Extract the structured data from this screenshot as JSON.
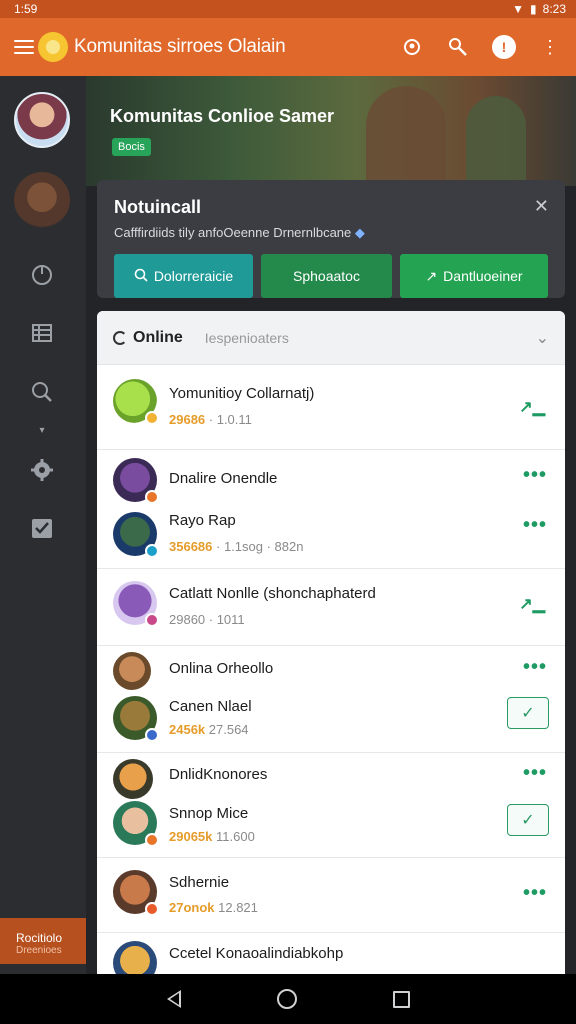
{
  "status": {
    "time": "1:59",
    "right_time": "8:23"
  },
  "app": {
    "title": "Komunitas sirroes Olaiain"
  },
  "banner": {
    "title": "Komunitas Conlioe Samer",
    "tag": "Bocis"
  },
  "rail": {
    "bottom_line1": "Rocitiolo",
    "bottom_line2": "Dreenioes"
  },
  "notice": {
    "title": "Notuincall",
    "text": "Cafffirdiids tily anfoOeenne Drnernlbcane",
    "buttons": [
      {
        "label": "Dolorreraicie"
      },
      {
        "label": "Sphoaatoc"
      },
      {
        "label": "Dantluoeiner"
      }
    ]
  },
  "list": {
    "header": {
      "tab": "Online",
      "sub": "Iespenioaters"
    },
    "rows": [
      {
        "name": "Yomunitioy Collarnatj)",
        "num": "29686",
        "meta": " · 1.0.11",
        "action": "trend"
      },
      {
        "name": "Dnalire Onendle",
        "num": "",
        "meta": "",
        "action": "more"
      },
      {
        "name": "Rayo Rap",
        "num": "356686",
        "meta": " · 1.1sog · 882n",
        "action": "more"
      },
      {
        "name": "Catlatt Nonlle (shonchaphaterd",
        "num": "",
        "meta": "29860 · 1011",
        "action": "trend"
      },
      {
        "name": "Onlina Orheollo",
        "num": "",
        "meta": "",
        "action": "more"
      },
      {
        "name": "Canen Nlael",
        "num": "2456k",
        "meta": " 27.564",
        "action": "check"
      },
      {
        "name": "DnlidKnonores",
        "num": "",
        "meta": "",
        "action": "more"
      },
      {
        "name": "Snnop Mice",
        "num": "29065k",
        "meta": " 11.600",
        "action": "check"
      },
      {
        "name": "Sdhernie",
        "num": "27onok",
        "meta": " 12.821",
        "action": "more"
      },
      {
        "name": "Ccetel Konaoalindiabkohp",
        "num": "",
        "meta": "",
        "action": "none"
      }
    ]
  },
  "icons": {
    "menu": "hamburger-icon",
    "actions": [
      "search-user-icon",
      "link-icon",
      "help-icon",
      "overflow-icon"
    ],
    "rail": [
      "power-icon",
      "list-icon",
      "search-icon",
      "gear-icon",
      "checkbox-icon"
    ]
  }
}
